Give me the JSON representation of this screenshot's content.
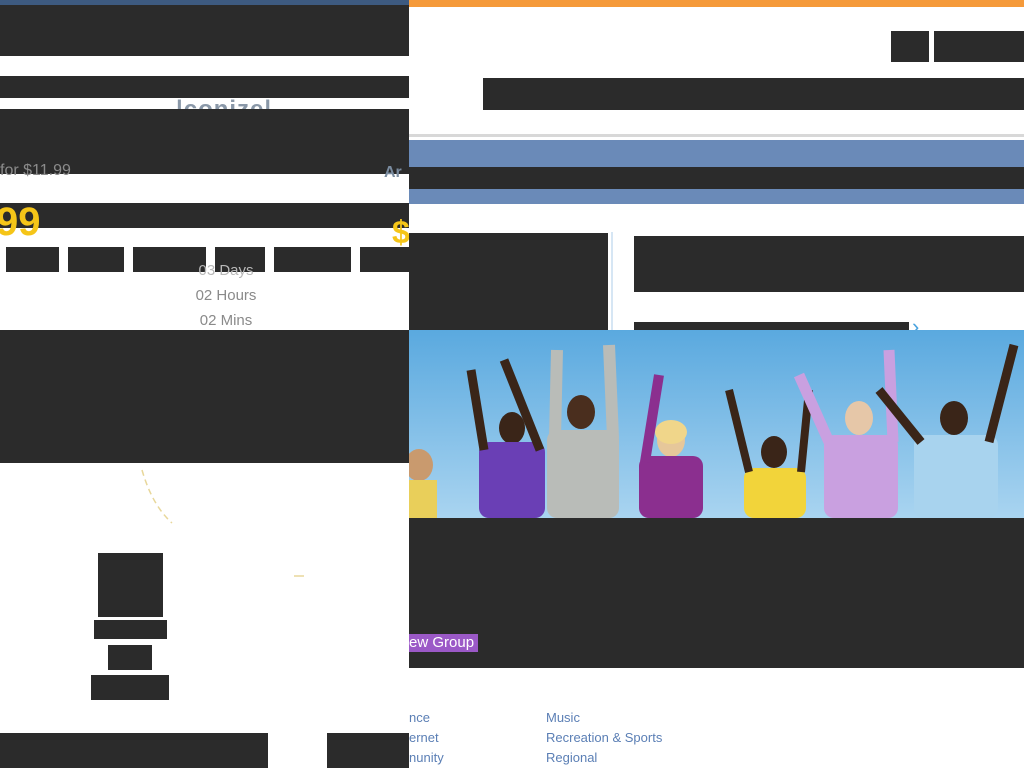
{
  "header": {
    "logo_fragment": "|conize|",
    "price_fragment": "for $11.99",
    "big_price_fragment": "99",
    "big_price_fragment_right": "$",
    "nav_fragment": "Ar"
  },
  "countdown": {
    "days": "03 Days",
    "hours": "02 Hours",
    "mins": "02 Mins"
  },
  "groups": {
    "new_group_label": "ew Group"
  },
  "categories": {
    "col1": [
      "nce",
      "ernet",
      "nunity"
    ],
    "col2": [
      "Music",
      "Recreation & Sports",
      "Regional"
    ]
  },
  "colors": {
    "accent_orange": "#f59a3a",
    "nav_blue": "#6a8ab8",
    "countdown_yellow": "#f5c518",
    "group_purple": "#9b59c7",
    "link_blue": "#5b7fb5"
  }
}
